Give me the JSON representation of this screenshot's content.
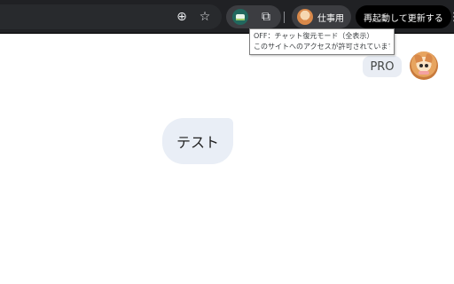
{
  "browser": {
    "toolbar_icons": [
      "zoom-icon",
      "star-icon",
      "extension-teal-icon",
      "extensions-puzzle-icon",
      "kebab-menu-icon"
    ],
    "profile_label": "仕事用",
    "update_label": "再起動して更新する",
    "zoom_glyph": "⊕",
    "star_glyph": "☆",
    "puzzle_glyph": "⧉",
    "kebab_glyph": "⋮"
  },
  "tooltip": {
    "line1": "OFF：チャット復元モード（全表示）",
    "line2": "このサイトへのアクセスが許可されています"
  },
  "header": {
    "plan_badge": "PRO"
  },
  "chat": {
    "user_message": "テスト"
  },
  "colors": {
    "toolbar_bg": "#202124",
    "bubble_bg": "#e9eef6",
    "badge_bg": "#e9edf4",
    "extension_teal": "#21685e"
  }
}
